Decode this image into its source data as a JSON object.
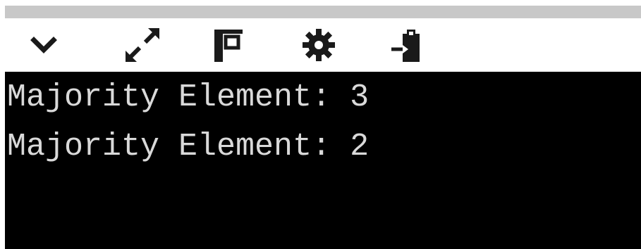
{
  "toolbar": {
    "icons": [
      {
        "name": "chevron-down-icon",
        "color": "#1a1a1a"
      },
      {
        "name": "expand-icon",
        "color": "#1a1a1a"
      },
      {
        "name": "pin-icon",
        "color": "#1a1a1a"
      },
      {
        "name": "gear-icon",
        "color": "#1a1a1a"
      },
      {
        "name": "paste-icon",
        "color": "#1a1a1a"
      }
    ]
  },
  "console": {
    "background": "#000000",
    "text_color": "#d9d9d9",
    "lines": [
      "Majority Element: 3",
      "Majority Element: 2"
    ]
  }
}
